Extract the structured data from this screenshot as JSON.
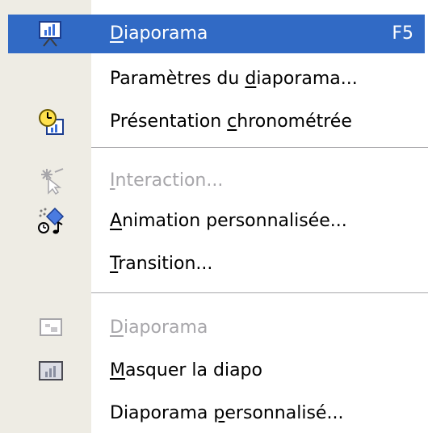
{
  "menu": {
    "items": [
      {
        "pre": "",
        "mn": "D",
        "post": "iaporama",
        "shortcut": "F5",
        "icon": "slideshow-icon"
      },
      {
        "pre": "Paramètres du ",
        "mn": "d",
        "post": "iaporama...",
        "shortcut": "",
        "icon": ""
      },
      {
        "pre": "Présentation ",
        "mn": "c",
        "post": "hronométrée",
        "shortcut": "",
        "icon": "rehearse-timings-clock-icon"
      },
      {
        "pre": "",
        "mn": "I",
        "post": "nteraction...",
        "shortcut": "",
        "icon": "action-settings-icon"
      },
      {
        "pre": "",
        "mn": "A",
        "post": "nimation personnalisée...",
        "shortcut": "",
        "icon": "custom-animation-icon"
      },
      {
        "pre": "",
        "mn": "T",
        "post": "ransition...",
        "shortcut": "",
        "icon": ""
      },
      {
        "pre": "",
        "mn": "D",
        "post": "iaporama",
        "shortcut": "",
        "icon": "slideshow-disabled-icon"
      },
      {
        "pre": "",
        "mn": "M",
        "post": "asquer la diapo",
        "shortcut": "",
        "icon": "hide-slide-icon"
      },
      {
        "pre": "Diaporama ",
        "mn": "p",
        "post": "ersonnalisé...",
        "shortcut": "",
        "icon": ""
      }
    ]
  },
  "colors": {
    "highlight": "#316ac5",
    "icon_strip": "#eeece4",
    "disabled_text": "#a7a6aa"
  }
}
